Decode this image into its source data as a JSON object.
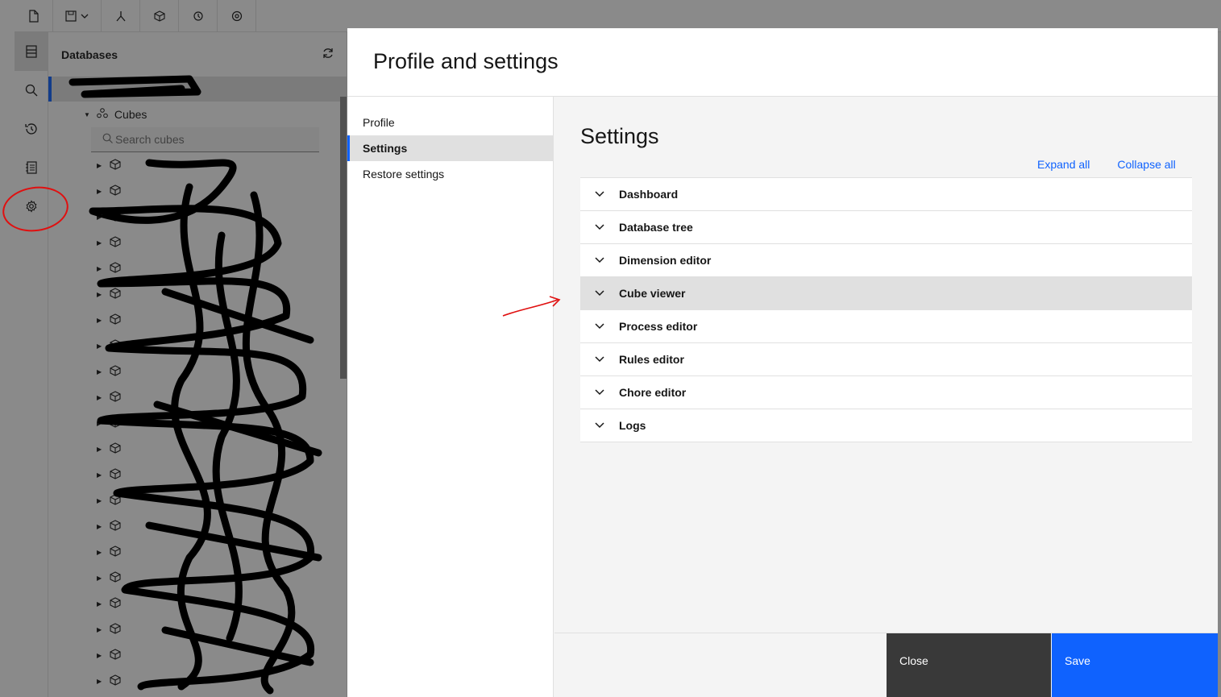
{
  "database_panel": {
    "title": "Databases",
    "folder_label": "Cubes",
    "search_placeholder": "Search cubes"
  },
  "modal": {
    "title": "Profile and settings",
    "nav": [
      {
        "label": "Profile"
      },
      {
        "label": "Settings"
      },
      {
        "label": "Restore settings"
      }
    ],
    "content_title": "Settings",
    "expand_all": "Expand all",
    "collapse_all": "Collapse all",
    "sections": [
      {
        "label": "Dashboard"
      },
      {
        "label": "Database tree"
      },
      {
        "label": "Dimension editor"
      },
      {
        "label": "Cube viewer"
      },
      {
        "label": "Process editor"
      },
      {
        "label": "Rules editor"
      },
      {
        "label": "Chore editor"
      },
      {
        "label": "Logs"
      }
    ],
    "close_label": "Close",
    "save_label": "Save"
  },
  "colors": {
    "primary": "#0f62fe",
    "secondary_button": "#393939",
    "annotation": "#e01010"
  }
}
